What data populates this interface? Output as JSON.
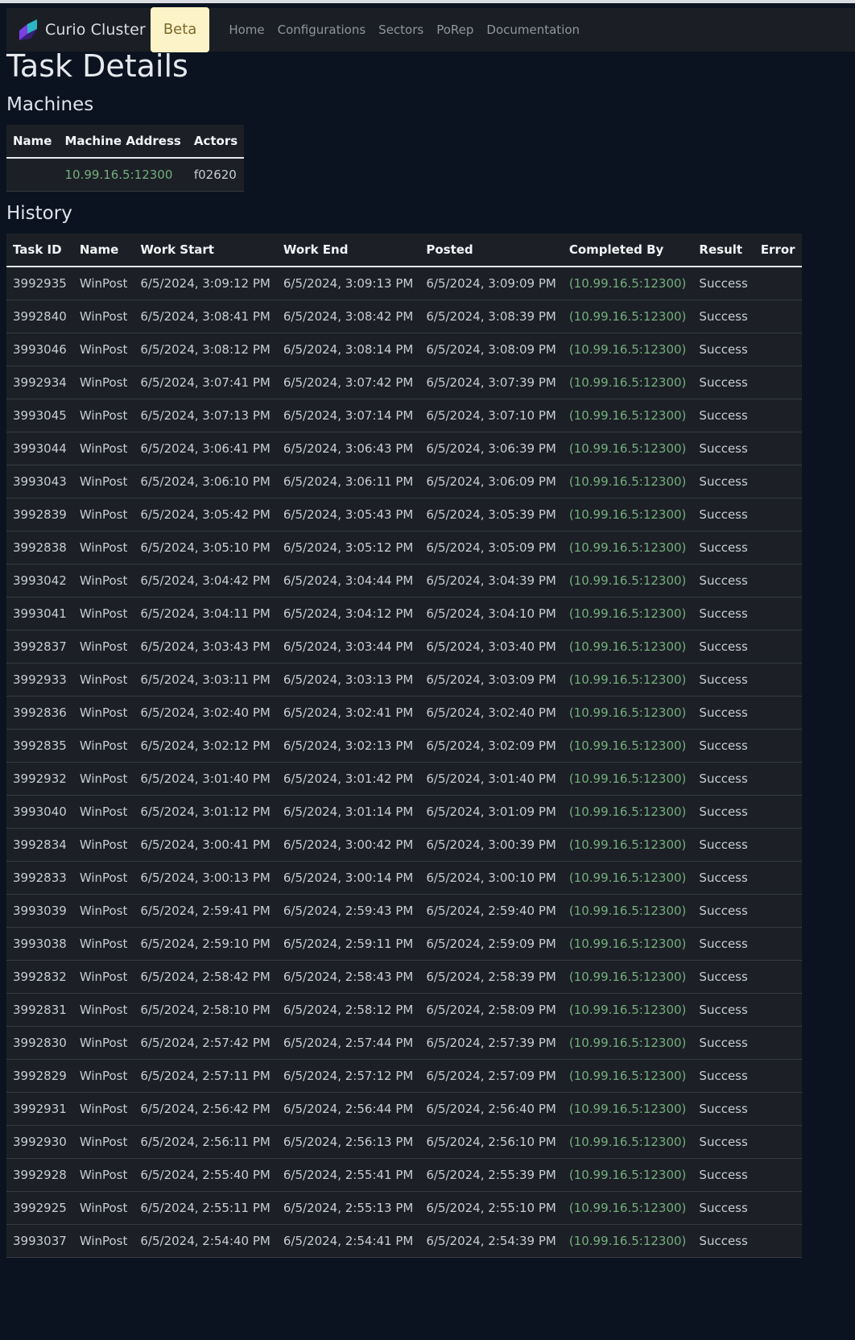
{
  "nav": {
    "brand": "Curio Cluster",
    "beta": "Beta",
    "links": [
      "Home",
      "Configurations",
      "Sectors",
      "PoRep",
      "Documentation"
    ]
  },
  "page_title": "Task Details",
  "machines": {
    "title": "Machines",
    "headers": [
      "Name",
      "Machine Address",
      "Actors"
    ],
    "rows": [
      {
        "name": "",
        "address": "10.99.16.5:12300",
        "actors": "f02620"
      }
    ]
  },
  "history": {
    "title": "History",
    "headers": [
      "Task ID",
      "Name",
      "Work Start",
      "Work End",
      "Posted",
      "Completed By",
      "Result",
      "Error"
    ],
    "rows": [
      [
        "3992935",
        "WinPost",
        "6/5/2024, 3:09:12 PM",
        "6/5/2024, 3:09:13 PM",
        "6/5/2024, 3:09:09 PM",
        "(10.99.16.5:12300)",
        "Success",
        ""
      ],
      [
        "3992840",
        "WinPost",
        "6/5/2024, 3:08:41 PM",
        "6/5/2024, 3:08:42 PM",
        "6/5/2024, 3:08:39 PM",
        "(10.99.16.5:12300)",
        "Success",
        ""
      ],
      [
        "3993046",
        "WinPost",
        "6/5/2024, 3:08:12 PM",
        "6/5/2024, 3:08:14 PM",
        "6/5/2024, 3:08:09 PM",
        "(10.99.16.5:12300)",
        "Success",
        ""
      ],
      [
        "3992934",
        "WinPost",
        "6/5/2024, 3:07:41 PM",
        "6/5/2024, 3:07:42 PM",
        "6/5/2024, 3:07:39 PM",
        "(10.99.16.5:12300)",
        "Success",
        ""
      ],
      [
        "3993045",
        "WinPost",
        "6/5/2024, 3:07:13 PM",
        "6/5/2024, 3:07:14 PM",
        "6/5/2024, 3:07:10 PM",
        "(10.99.16.5:12300)",
        "Success",
        ""
      ],
      [
        "3993044",
        "WinPost",
        "6/5/2024, 3:06:41 PM",
        "6/5/2024, 3:06:43 PM",
        "6/5/2024, 3:06:39 PM",
        "(10.99.16.5:12300)",
        "Success",
        ""
      ],
      [
        "3993043",
        "WinPost",
        "6/5/2024, 3:06:10 PM",
        "6/5/2024, 3:06:11 PM",
        "6/5/2024, 3:06:09 PM",
        "(10.99.16.5:12300)",
        "Success",
        ""
      ],
      [
        "3992839",
        "WinPost",
        "6/5/2024, 3:05:42 PM",
        "6/5/2024, 3:05:43 PM",
        "6/5/2024, 3:05:39 PM",
        "(10.99.16.5:12300)",
        "Success",
        ""
      ],
      [
        "3992838",
        "WinPost",
        "6/5/2024, 3:05:10 PM",
        "6/5/2024, 3:05:12 PM",
        "6/5/2024, 3:05:09 PM",
        "(10.99.16.5:12300)",
        "Success",
        ""
      ],
      [
        "3993042",
        "WinPost",
        "6/5/2024, 3:04:42 PM",
        "6/5/2024, 3:04:44 PM",
        "6/5/2024, 3:04:39 PM",
        "(10.99.16.5:12300)",
        "Success",
        ""
      ],
      [
        "3993041",
        "WinPost",
        "6/5/2024, 3:04:11 PM",
        "6/5/2024, 3:04:12 PM",
        "6/5/2024, 3:04:10 PM",
        "(10.99.16.5:12300)",
        "Success",
        ""
      ],
      [
        "3992837",
        "WinPost",
        "6/5/2024, 3:03:43 PM",
        "6/5/2024, 3:03:44 PM",
        "6/5/2024, 3:03:40 PM",
        "(10.99.16.5:12300)",
        "Success",
        ""
      ],
      [
        "3992933",
        "WinPost",
        "6/5/2024, 3:03:11 PM",
        "6/5/2024, 3:03:13 PM",
        "6/5/2024, 3:03:09 PM",
        "(10.99.16.5:12300)",
        "Success",
        ""
      ],
      [
        "3992836",
        "WinPost",
        "6/5/2024, 3:02:40 PM",
        "6/5/2024, 3:02:41 PM",
        "6/5/2024, 3:02:40 PM",
        "(10.99.16.5:12300)",
        "Success",
        ""
      ],
      [
        "3992835",
        "WinPost",
        "6/5/2024, 3:02:12 PM",
        "6/5/2024, 3:02:13 PM",
        "6/5/2024, 3:02:09 PM",
        "(10.99.16.5:12300)",
        "Success",
        ""
      ],
      [
        "3992932",
        "WinPost",
        "6/5/2024, 3:01:40 PM",
        "6/5/2024, 3:01:42 PM",
        "6/5/2024, 3:01:40 PM",
        "(10.99.16.5:12300)",
        "Success",
        ""
      ],
      [
        "3993040",
        "WinPost",
        "6/5/2024, 3:01:12 PM",
        "6/5/2024, 3:01:14 PM",
        "6/5/2024, 3:01:09 PM",
        "(10.99.16.5:12300)",
        "Success",
        ""
      ],
      [
        "3992834",
        "WinPost",
        "6/5/2024, 3:00:41 PM",
        "6/5/2024, 3:00:42 PM",
        "6/5/2024, 3:00:39 PM",
        "(10.99.16.5:12300)",
        "Success",
        ""
      ],
      [
        "3992833",
        "WinPost",
        "6/5/2024, 3:00:13 PM",
        "6/5/2024, 3:00:14 PM",
        "6/5/2024, 3:00:10 PM",
        "(10.99.16.5:12300)",
        "Success",
        ""
      ],
      [
        "3993039",
        "WinPost",
        "6/5/2024, 2:59:41 PM",
        "6/5/2024, 2:59:43 PM",
        "6/5/2024, 2:59:40 PM",
        "(10.99.16.5:12300)",
        "Success",
        ""
      ],
      [
        "3993038",
        "WinPost",
        "6/5/2024, 2:59:10 PM",
        "6/5/2024, 2:59:11 PM",
        "6/5/2024, 2:59:09 PM",
        "(10.99.16.5:12300)",
        "Success",
        ""
      ],
      [
        "3992832",
        "WinPost",
        "6/5/2024, 2:58:42 PM",
        "6/5/2024, 2:58:43 PM",
        "6/5/2024, 2:58:39 PM",
        "(10.99.16.5:12300)",
        "Success",
        ""
      ],
      [
        "3992831",
        "WinPost",
        "6/5/2024, 2:58:10 PM",
        "6/5/2024, 2:58:12 PM",
        "6/5/2024, 2:58:09 PM",
        "(10.99.16.5:12300)",
        "Success",
        ""
      ],
      [
        "3992830",
        "WinPost",
        "6/5/2024, 2:57:42 PM",
        "6/5/2024, 2:57:44 PM",
        "6/5/2024, 2:57:39 PM",
        "(10.99.16.5:12300)",
        "Success",
        ""
      ],
      [
        "3992829",
        "WinPost",
        "6/5/2024, 2:57:11 PM",
        "6/5/2024, 2:57:12 PM",
        "6/5/2024, 2:57:09 PM",
        "(10.99.16.5:12300)",
        "Success",
        ""
      ],
      [
        "3992931",
        "WinPost",
        "6/5/2024, 2:56:42 PM",
        "6/5/2024, 2:56:44 PM",
        "6/5/2024, 2:56:40 PM",
        "(10.99.16.5:12300)",
        "Success",
        ""
      ],
      [
        "3992930",
        "WinPost",
        "6/5/2024, 2:56:11 PM",
        "6/5/2024, 2:56:13 PM",
        "6/5/2024, 2:56:10 PM",
        "(10.99.16.5:12300)",
        "Success",
        ""
      ],
      [
        "3992928",
        "WinPost",
        "6/5/2024, 2:55:40 PM",
        "6/5/2024, 2:55:41 PM",
        "6/5/2024, 2:55:39 PM",
        "(10.99.16.5:12300)",
        "Success",
        ""
      ],
      [
        "3992925",
        "WinPost",
        "6/5/2024, 2:55:11 PM",
        "6/5/2024, 2:55:13 PM",
        "6/5/2024, 2:55:10 PM",
        "(10.99.16.5:12300)",
        "Success",
        ""
      ],
      [
        "3993037",
        "WinPost",
        "6/5/2024, 2:54:40 PM",
        "6/5/2024, 2:54:41 PM",
        "6/5/2024, 2:54:39 PM",
        "(10.99.16.5:12300)",
        "Success",
        ""
      ]
    ]
  },
  "colors": {
    "background": "#0b1320",
    "table_background": "#1c2026",
    "address_green": "#74ad7d",
    "beta_background": "#fdf3c8"
  }
}
